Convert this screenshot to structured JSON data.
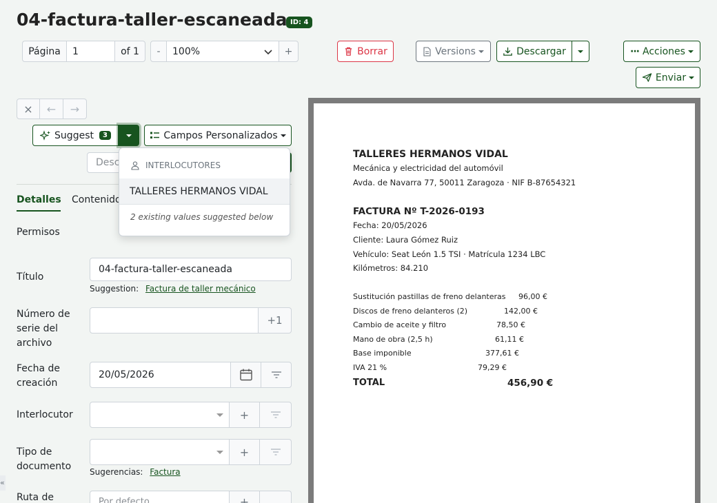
{
  "header": {
    "title": "04-factura-taller-escaneada",
    "id_badge": "ID: 4"
  },
  "toolbar": {
    "page_label": "Página",
    "page_value": "1",
    "page_of": "of 1",
    "zoom_minus": "-",
    "zoom_value": "100%",
    "zoom_plus": "+",
    "delete_label": "Borrar",
    "versions_label": "Versions",
    "download_label": "Descargar",
    "actions_label": "Acciones",
    "send_label": "Enviar"
  },
  "nav": {
    "close": "×",
    "prev": "←",
    "next": "→"
  },
  "suggest": {
    "label": "Suggest",
    "count": "3",
    "custom_fields_label": "Campos Personalizados"
  },
  "search": {
    "placeholder_visible": "Desca"
  },
  "dropdown": {
    "section_header": "INTERLOCUTORES",
    "item": "TALLERES HERMANOS VIDAL",
    "footer": "2 existing values suggested below"
  },
  "tabs": [
    {
      "label": "Detalles",
      "active": true
    },
    {
      "label": "Contenido",
      "active": false
    }
  ],
  "form": {
    "permisos_label": "Permisos",
    "title_label": "Título",
    "title_value": "04-factura-taller-escaneada",
    "title_suggestion_prefix": "Suggestion:",
    "title_suggestion": "Factura de taller mecánico",
    "serial_label": "Número de serie del archivo",
    "serial_button": "+1",
    "date_label": "Fecha de creación",
    "date_value": "20/05/2026",
    "interlocutor_label": "Interlocutor",
    "interlocutor_add": "+",
    "doctype_label": "Tipo de documento",
    "doctype_add": "+",
    "doctype_suggestion_prefix": "Sugerencias:",
    "doctype_suggestion": "Factura",
    "path_label": "Ruta de",
    "path_placeholder": "Por defecto",
    "path_add": "+"
  },
  "document": {
    "company": "TALLERES HERMANOS VIDAL",
    "subtitle": "Mecánica y electricidad del automóvil",
    "address": "Avda. de Navarra 77, 50011 Zaragoza · NIF B-87654321",
    "invoice_title": "FACTURA Nº T-2026-0193",
    "date": "Fecha: 20/05/2026",
    "client": "Cliente: Laura Gómez Ruiz",
    "vehicle": "Vehículo: Seat León 1.5 TSI · Matrícula 1234 LBC",
    "km": "Kilómetros: 84.210",
    "lines": [
      {
        "desc": "Sustitución pastillas de freno delanteras",
        "amount": "96,00 €"
      },
      {
        "desc": "Discos de freno delanteros (2)",
        "amount": "142,00 €"
      },
      {
        "desc": "Cambio de aceite y filtro",
        "amount": "78,50 €"
      },
      {
        "desc": "Mano de obra (2,5 h)",
        "amount": "61,11 €"
      },
      {
        "desc": "Base imponible",
        "amount": "377,61 €"
      },
      {
        "desc": "IVA 21 %",
        "amount": "79,29 €"
      }
    ],
    "total_label": "TOTAL",
    "total_value": "456,90 €"
  },
  "sidebar_toggle": "«",
  "colors": {
    "accent": "#17541f",
    "danger": "#dc3545",
    "background": "#f2f5f3"
  }
}
